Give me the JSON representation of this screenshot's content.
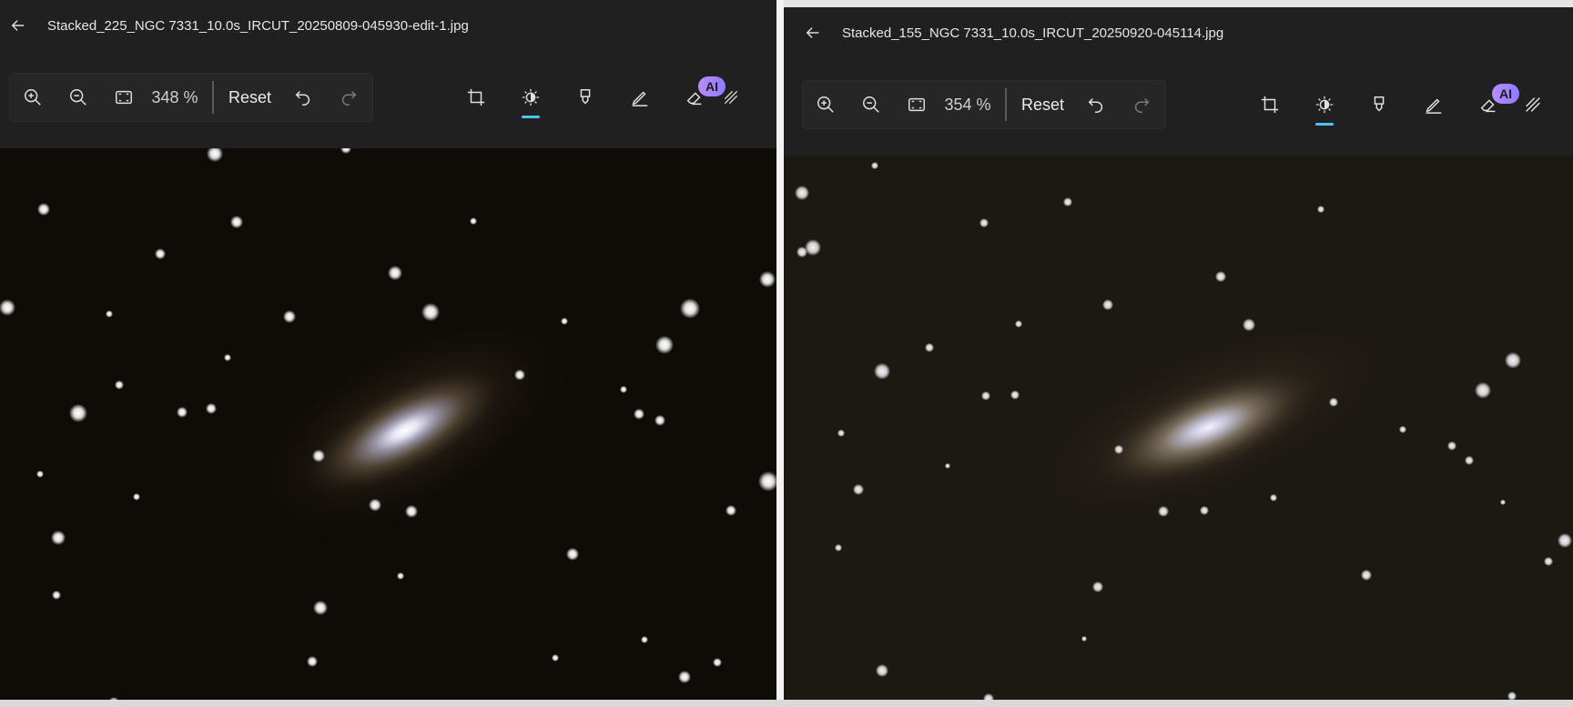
{
  "left": {
    "title": "Stacked_225_NGC 7331_10.0s_IRCUT_20250809-045930-edit-1.jpg",
    "zoom": "348 %",
    "reset_label": "Reset",
    "ai_badge": "AI"
  },
  "right": {
    "title": "Stacked_155_NGC 7331_10.0s_IRCUT_20250920-045114.jpg",
    "zoom": "354 %",
    "reset_label": "Reset",
    "ai_badge": "AI"
  },
  "icons": [
    "back-arrow-icon",
    "zoom-in-icon",
    "zoom-out-icon",
    "fit-screen-icon",
    "undo-icon",
    "redo-icon",
    "crop-icon",
    "brightness-icon",
    "markup-icon",
    "draw-icon",
    "erase-ai-icon",
    "filter-icon"
  ],
  "colors": {
    "accent": "#4cc2ff",
    "bg": "#202020",
    "ai": "#a98cff"
  }
}
